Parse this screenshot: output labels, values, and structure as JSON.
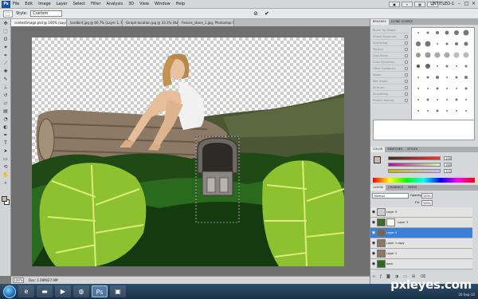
{
  "app": {
    "logo": "Ps"
  },
  "menu": {
    "items": [
      "File",
      "Edit",
      "Image",
      "Layer",
      "Select",
      "Filter",
      "Analysis",
      "3D",
      "View",
      "Window",
      "Help"
    ]
  },
  "workspace": {
    "label": "UNTITLED-1"
  },
  "options": {
    "style_label": "Style:",
    "style_value": "Custom"
  },
  "tabs": [
    {
      "label": "contestimage.psd @ 100% (Layer 4, RGB/8)"
    },
    {
      "label": "landbird.jpg @ 66.7% (Layer 1, RGB/8)"
    },
    {
      "label": "Giraph-location.jpg @ 33.3% (Background, RGB/8)"
    },
    {
      "label": "Fences_stone_1.jpg, Photoshop Stock.jpg @ 66.7% (Layer 1, RGB/8)"
    }
  ],
  "status": {
    "zoom": "100%",
    "doc": "Doc: 1.00M/27.9M"
  },
  "brushes_panel": {
    "tabs": [
      "BRUSHES",
      "CLONE SOURCE"
    ],
    "settings": [
      "Brush Tip Shape",
      "Shape Dynamics",
      "Scattering",
      "Texture",
      "Dual Brush",
      "Color Dynamics",
      "Other Dynamics",
      "Noise",
      "Wet Edges",
      "Airbrush",
      "Smoothing",
      "Protect Texture"
    ]
  },
  "color_panel": {
    "tabs": [
      "COLOR",
      "SWATCHES",
      "STYLES"
    ],
    "r": "200",
    "g": "185",
    "b": "172",
    "fg_color": "#c8b9ac"
  },
  "layers_panel": {
    "tabs": [
      "LAYERS",
      "CHANNELS",
      "PATHS"
    ],
    "blend": "Normal",
    "opacity_label": "Opacity:",
    "opacity": "100%",
    "fill_label": "Fill:",
    "fill": "100%",
    "layers": [
      {
        "name": "Layer 5"
      },
      {
        "name": "Layer 3"
      },
      {
        "name": "Layer 4",
        "selected": true
      },
      {
        "name": "Layer 1 copy"
      },
      {
        "name": "Layer 1"
      },
      {
        "name": "back"
      }
    ]
  },
  "watermark": "pxleyes.com",
  "tray": {
    "date": "26-Sep-10"
  }
}
